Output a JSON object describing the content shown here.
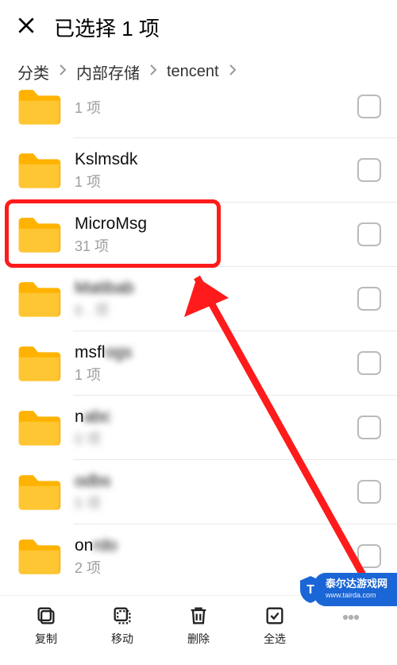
{
  "header": {
    "title": "已选择 1 项"
  },
  "breadcrumb": {
    "items": [
      "分类",
      "内部存储",
      "tencent"
    ]
  },
  "folders": [
    {
      "name": "",
      "subtitle": "1 项",
      "blurName": false,
      "blurSub": false,
      "partial": true
    },
    {
      "name": "Kslmsdk",
      "subtitle": "1 项",
      "blurName": false,
      "blurSub": false
    },
    {
      "name": "MicroMsg",
      "subtitle": "31 项",
      "blurName": false,
      "blurSub": false,
      "highlighted": true
    },
    {
      "name": "Matibab",
      "subtitle": "6 . 项",
      "blurName": true,
      "blurSub": true
    },
    {
      "name": "msflogs",
      "subtitle": "1 项",
      "blurName": true,
      "blurSub": false
    },
    {
      "name": "nabc",
      "subtitle": "0 项",
      "blurName": true,
      "blurSub": true
    },
    {
      "name": "odbs",
      "subtitle": "5 项",
      "blurName": true,
      "blurSub": true
    },
    {
      "name": "onrdo",
      "subtitle": "2 项",
      "blurName": true,
      "blurSub": false
    }
  ],
  "bottombar": {
    "copy": "复制",
    "move": "移动",
    "delete": "删除",
    "select": "全选"
  },
  "watermark": {
    "line1": "泰尔达游戏网",
    "line2": "www.tairda.com"
  }
}
